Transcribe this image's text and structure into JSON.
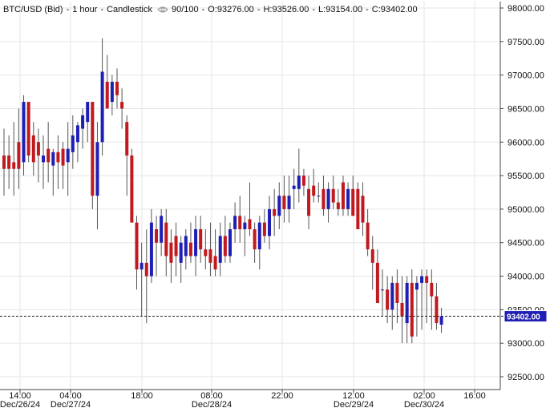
{
  "header": {
    "symbol": "BTC/USD (Bid)",
    "interval": "1 hour",
    "chart_style": "Candlestick",
    "visibility": "90/100",
    "open": "O:93276.00",
    "high": "H:93526.00",
    "low": "L:93154.00",
    "close": "C:93402.00",
    "separator": "-"
  },
  "colors": {
    "up": "#1f1fb4",
    "down": "#c0191e",
    "grid": "#e6e6e6",
    "price_box": "#1f1fb4"
  },
  "chart_data": {
    "type": "candlestick",
    "title": "BTC/USD (Bid) - 1 hour - Candlestick",
    "ylim": [
      92250,
      98100
    ],
    "y_ticks": [
      92500,
      93000,
      93500,
      94000,
      94500,
      95000,
      95500,
      96000,
      96500,
      97000,
      97500,
      98000
    ],
    "y_tick_labels": [
      "92500.00",
      "93000.00",
      "93500.00",
      "94000.00",
      "94500.00",
      "95000.00",
      "95500.00",
      "96000.00",
      "96500.00",
      "97000.00",
      "97500.00",
      "98000.00"
    ],
    "x_time_labels": [
      "14:00",
      "04:00",
      "18:00",
      "08:00",
      "22:00",
      "12:00",
      "02:00",
      "16:00"
    ],
    "x_date_labels": [
      "Dec/26/24",
      "Dec/27/24",
      "Dec/28/24",
      "Dec/29/24",
      "Dec/30/24"
    ],
    "last_price": 93402,
    "last_price_label": "93402.00",
    "grid": true,
    "candles": [
      {
        "o": 95800,
        "h": 96200,
        "l": 95200,
        "c": 95600
      },
      {
        "o": 95800,
        "h": 96100,
        "l": 95300,
        "c": 95600
      },
      {
        "o": 95700,
        "h": 96300,
        "l": 95200,
        "c": 95600
      },
      {
        "o": 96000,
        "h": 96500,
        "l": 95300,
        "c": 95600
      },
      {
        "o": 95700,
        "h": 96700,
        "l": 95500,
        "c": 96600
      },
      {
        "o": 96600,
        "h": 96600,
        "l": 95700,
        "c": 95800
      },
      {
        "o": 96100,
        "h": 96300,
        "l": 95500,
        "c": 95700
      },
      {
        "o": 96000,
        "h": 96200,
        "l": 95400,
        "c": 95800
      },
      {
        "o": 95700,
        "h": 96100,
        "l": 95300,
        "c": 95800
      },
      {
        "o": 95900,
        "h": 96300,
        "l": 95400,
        "c": 95700
      },
      {
        "o": 95650,
        "h": 95900,
        "l": 95200,
        "c": 95850
      },
      {
        "o": 95850,
        "h": 96100,
        "l": 95300,
        "c": 95700
      },
      {
        "o": 95900,
        "h": 96000,
        "l": 95300,
        "c": 95650
      },
      {
        "o": 95700,
        "h": 96300,
        "l": 95200,
        "c": 95900
      },
      {
        "o": 95850,
        "h": 96400,
        "l": 95600,
        "c": 96100
      },
      {
        "o": 96000,
        "h": 96300,
        "l": 95700,
        "c": 96250
      },
      {
        "o": 96200,
        "h": 96500,
        "l": 95900,
        "c": 96400
      },
      {
        "o": 96300,
        "h": 96600,
        "l": 96000,
        "c": 96600
      },
      {
        "o": 96600,
        "h": 96600,
        "l": 95000,
        "c": 95200
      },
      {
        "o": 95200,
        "h": 96300,
        "l": 94700,
        "c": 96000
      },
      {
        "o": 96000,
        "h": 97550,
        "l": 95800,
        "c": 97050
      },
      {
        "o": 96900,
        "h": 97300,
        "l": 96500,
        "c": 96500
      },
      {
        "o": 96600,
        "h": 97000,
        "l": 96400,
        "c": 96900
      },
      {
        "o": 96900,
        "h": 97100,
        "l": 96500,
        "c": 96700
      },
      {
        "o": 96600,
        "h": 96800,
        "l": 96200,
        "c": 96500
      },
      {
        "o": 96300,
        "h": 96400,
        "l": 95200,
        "c": 95800
      },
      {
        "o": 95800,
        "h": 95900,
        "l": 94900,
        "c": 94800
      },
      {
        "o": 94800,
        "h": 94900,
        "l": 93800,
        "c": 94100
      },
      {
        "o": 94100,
        "h": 94500,
        "l": 93400,
        "c": 94200
      },
      {
        "o": 94200,
        "h": 94700,
        "l": 93300,
        "c": 94000
      },
      {
        "o": 94000,
        "h": 95000,
        "l": 93900,
        "c": 94800
      },
      {
        "o": 94700,
        "h": 94900,
        "l": 94000,
        "c": 94500
      },
      {
        "o": 94500,
        "h": 95000,
        "l": 94300,
        "c": 94900
      },
      {
        "o": 94800,
        "h": 95000,
        "l": 94000,
        "c": 94300
      },
      {
        "o": 94500,
        "h": 94700,
        "l": 93900,
        "c": 94200
      },
      {
        "o": 94600,
        "h": 94800,
        "l": 94000,
        "c": 94300
      },
      {
        "o": 94200,
        "h": 94600,
        "l": 93900,
        "c": 94500
      },
      {
        "o": 94300,
        "h": 94700,
        "l": 94100,
        "c": 94600
      },
      {
        "o": 94500,
        "h": 94800,
        "l": 94200,
        "c": 94300
      },
      {
        "o": 94300,
        "h": 94900,
        "l": 94000,
        "c": 94700
      },
      {
        "o": 94700,
        "h": 94900,
        "l": 94200,
        "c": 94400
      },
      {
        "o": 94400,
        "h": 94700,
        "l": 94100,
        "c": 94300
      },
      {
        "o": 94400,
        "h": 94800,
        "l": 94000,
        "c": 94200
      },
      {
        "o": 94300,
        "h": 94700,
        "l": 94000,
        "c": 94100
      },
      {
        "o": 94200,
        "h": 94800,
        "l": 94000,
        "c": 94600
      },
      {
        "o": 94600,
        "h": 94900,
        "l": 94200,
        "c": 94300
      },
      {
        "o": 94300,
        "h": 94800,
        "l": 94200,
        "c": 94700
      },
      {
        "o": 94700,
        "h": 95100,
        "l": 94500,
        "c": 94900
      },
      {
        "o": 94900,
        "h": 95200,
        "l": 94500,
        "c": 94700
      },
      {
        "o": 94700,
        "h": 94900,
        "l": 94300,
        "c": 94800
      },
      {
        "o": 94850,
        "h": 95400,
        "l": 94600,
        "c": 94700
      },
      {
        "o": 94700,
        "h": 94800,
        "l": 94200,
        "c": 94400
      },
      {
        "o": 94400,
        "h": 94900,
        "l": 94100,
        "c": 94800
      },
      {
        "o": 94800,
        "h": 95000,
        "l": 94500,
        "c": 94600
      },
      {
        "o": 94600,
        "h": 95200,
        "l": 94400,
        "c": 95000
      },
      {
        "o": 95000,
        "h": 95300,
        "l": 94600,
        "c": 94900
      },
      {
        "o": 94900,
        "h": 95400,
        "l": 94700,
        "c": 95200
      },
      {
        "o": 95200,
        "h": 95500,
        "l": 94800,
        "c": 95000
      },
      {
        "o": 95000,
        "h": 95500,
        "l": 94800,
        "c": 95200
      },
      {
        "o": 95300,
        "h": 95600,
        "l": 95000,
        "c": 95350
      },
      {
        "o": 95300,
        "h": 95900,
        "l": 95100,
        "c": 95500
      },
      {
        "o": 95500,
        "h": 95600,
        "l": 95200,
        "c": 95350
      },
      {
        "o": 95300,
        "h": 95500,
        "l": 94700,
        "c": 94900
      },
      {
        "o": 95350,
        "h": 95600,
        "l": 95100,
        "c": 95200
      },
      {
        "o": 95200,
        "h": 95400,
        "l": 95100,
        "c": 95200
      },
      {
        "o": 95300,
        "h": 95500,
        "l": 94900,
        "c": 95000
      },
      {
        "o": 95000,
        "h": 95400,
        "l": 94800,
        "c": 95300
      },
      {
        "o": 95300,
        "h": 95500,
        "l": 95000,
        "c": 95100
      },
      {
        "o": 95100,
        "h": 95300,
        "l": 94900,
        "c": 95000
      },
      {
        "o": 95400,
        "h": 95500,
        "l": 94900,
        "c": 95000
      },
      {
        "o": 95000,
        "h": 95400,
        "l": 94900,
        "c": 95300
      },
      {
        "o": 95300,
        "h": 95500,
        "l": 94900,
        "c": 94900
      },
      {
        "o": 95300,
        "h": 95400,
        "l": 94700,
        "c": 94700
      },
      {
        "o": 95200,
        "h": 95400,
        "l": 94600,
        "c": 94800
      },
      {
        "o": 94800,
        "h": 95000,
        "l": 94300,
        "c": 94400
      },
      {
        "o": 94400,
        "h": 94600,
        "l": 93800,
        "c": 94200
      },
      {
        "o": 94200,
        "h": 94400,
        "l": 93600,
        "c": 93600
      },
      {
        "o": 93800,
        "h": 94100,
        "l": 93400,
        "c": 93800
      },
      {
        "o": 93800,
        "h": 94000,
        "l": 93300,
        "c": 93500
      },
      {
        "o": 93500,
        "h": 94000,
        "l": 93200,
        "c": 93900
      },
      {
        "o": 93900,
        "h": 94100,
        "l": 93300,
        "c": 93600
      },
      {
        "o": 93600,
        "h": 94000,
        "l": 93000,
        "c": 93400
      },
      {
        "o": 93300,
        "h": 94000,
        "l": 93000,
        "c": 93900
      },
      {
        "o": 93900,
        "h": 94100,
        "l": 93000,
        "c": 93100
      },
      {
        "o": 93800,
        "h": 94000,
        "l": 93100,
        "c": 93900
      },
      {
        "o": 93900,
        "h": 94100,
        "l": 93200,
        "c": 94000
      },
      {
        "o": 94000,
        "h": 94100,
        "l": 93300,
        "c": 93900
      },
      {
        "o": 93900,
        "h": 94100,
        "l": 93200,
        "c": 93700
      },
      {
        "o": 93700,
        "h": 93900,
        "l": 93200,
        "c": 93300
      },
      {
        "o": 93276,
        "h": 93526,
        "l": 93154,
        "c": 93402
      }
    ]
  }
}
